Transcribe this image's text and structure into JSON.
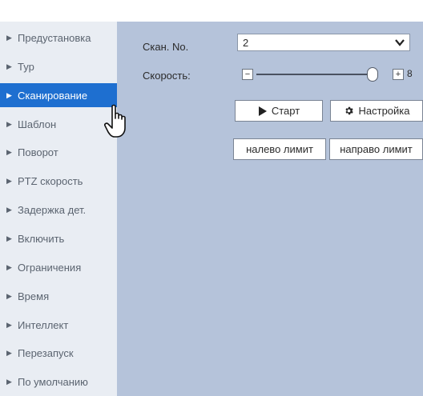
{
  "sidebar": {
    "active_index": 2,
    "items": [
      {
        "label": "Предустановка"
      },
      {
        "label": "Тур"
      },
      {
        "label": "Сканирование"
      },
      {
        "label": "Шаблон"
      },
      {
        "label": "Поворот"
      },
      {
        "label": "PTZ скорость"
      },
      {
        "label": "Задержка дет."
      },
      {
        "label": "Включить"
      },
      {
        "label": "Ограничения"
      },
      {
        "label": "Время"
      },
      {
        "label": "Интеллект"
      },
      {
        "label": "Перезапуск"
      },
      {
        "label": "По умолчанию"
      }
    ]
  },
  "scan": {
    "no_label": "Скан. No.",
    "no_value": "2",
    "speed_label": "Скорость:",
    "speed_value": "8",
    "speed_fraction": 1.0,
    "minus": "−",
    "plus": "+"
  },
  "buttons": {
    "start_label": "Старт",
    "setup_label": "Настройка",
    "left_limit_label": "налево лимит",
    "right_limit_label": "направо лимит"
  },
  "icons": {
    "arrow": "triangle-right-icon",
    "gear": "gear-icon",
    "cursor": "hand-pointer-icon"
  }
}
